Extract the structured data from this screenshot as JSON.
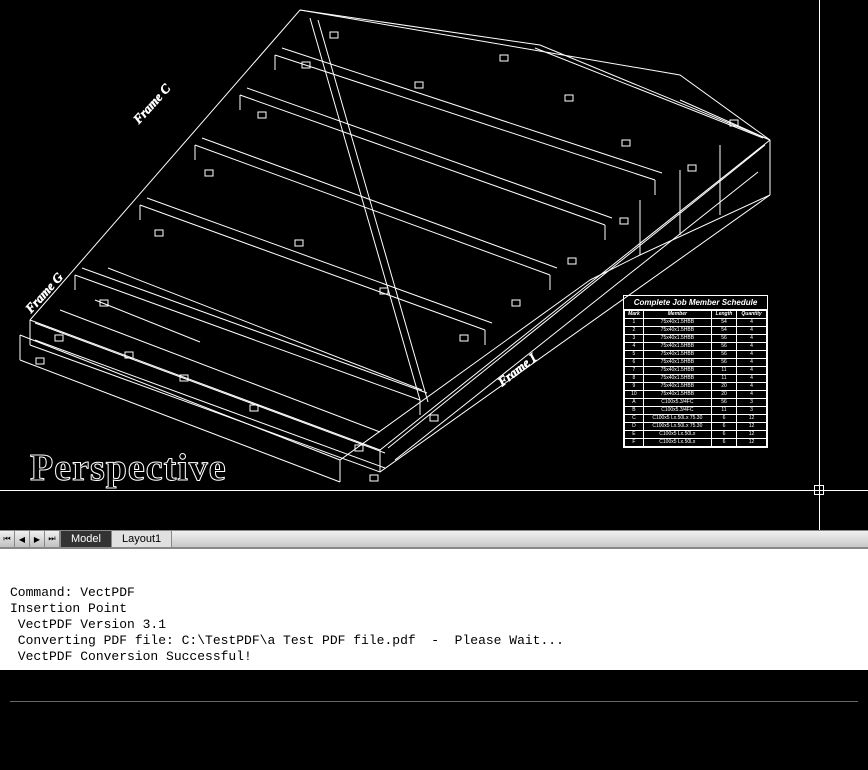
{
  "viewport": {
    "perspective_label": "Perspective",
    "frame_labels": {
      "frame_c_top": "Frame C",
      "frame_g": "Frame G",
      "frame_l": "Frame I"
    }
  },
  "schedule": {
    "title": "Complete Job Member Schedule",
    "headers": [
      "Mark",
      "Member",
      "Length",
      "Quantity"
    ],
    "rows": [
      [
        "1",
        "75x40x1.5HBB",
        "54",
        "4"
      ],
      [
        "2",
        "75x40x1.5HBB",
        "54",
        "4"
      ],
      [
        "3",
        "75x40x1.5HBB",
        "56",
        "4"
      ],
      [
        "4",
        "75x40x1.5HBB",
        "56",
        "4"
      ],
      [
        "5",
        "75x40x1.5HBB",
        "56",
        "4"
      ],
      [
        "6",
        "75x40x1.5HBB",
        "56",
        "4"
      ],
      [
        "7",
        "75x40x1.5HBB",
        "11",
        "4"
      ],
      [
        "8",
        "75x40x1.5HBB",
        "11",
        "4"
      ],
      [
        "9",
        "75x40x1.5HBB",
        "20",
        "4"
      ],
      [
        "10",
        "75x40x1.5HBB",
        "20",
        "4"
      ],
      [
        "A",
        "C100x5.3/4FC",
        "56",
        "3"
      ],
      [
        "B",
        "C100x5.3/4FC",
        "11",
        "3"
      ],
      [
        "C",
        "C100x5 Lx.50Lx 75.30",
        "6",
        "12"
      ],
      [
        "D",
        "C100x5 Lx.50Lx 75.30",
        "6",
        "12"
      ],
      [
        "E",
        "C100x5 Lx.50Lx",
        "6",
        "12"
      ],
      [
        "F",
        "C100x5 Lx.50Lx",
        "6",
        "12"
      ]
    ]
  },
  "tabs": {
    "model": "Model",
    "layout1": "Layout1"
  },
  "command": {
    "lines": [
      "Command: VectPDF",
      "Insertion Point",
      " VectPDF Version 3.1",
      " Converting PDF file: C:\\TestPDF\\a Test PDF file.pdf  -  Please Wait...",
      " VectPDF Conversion Successful!"
    ],
    "prompt": "Command:"
  }
}
